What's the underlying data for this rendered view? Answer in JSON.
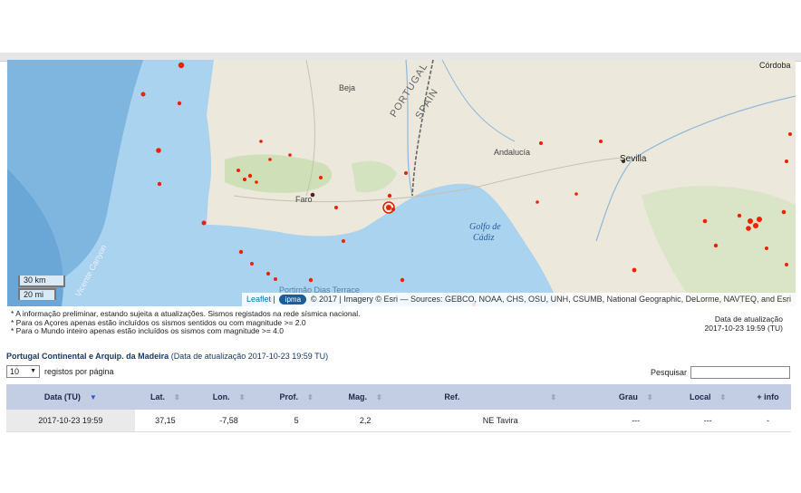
{
  "map": {
    "labels": {
      "beja": "Beja",
      "portugal": "PORTUGAL",
      "spain": "SPAIN",
      "andalucia": "Andalucía",
      "sevilla": "Sevilla",
      "cordoba": "Córdoba",
      "faro": "Faro",
      "golfo1": "Golfo de",
      "golfo2": "Cádiz",
      "canyon": "Vicente Canyon",
      "terrace": "Portimão Dias Terrace"
    },
    "scale_km": "30 km",
    "scale_mi": "20 mi",
    "attribution_leaflet": "Leaflet",
    "attribution_logo": "ipma",
    "attribution_text": "© 2017 | Imagery © Esri — Sources: GEBCO, NOAA, CHS, OSU, UNH, CSUMB, National Geographic, DeLorme, NAVTEQ, and Esri",
    "colors": {
      "ocean": "#a9d3ee",
      "deep_ocean": "#7fb6e0",
      "land": "#ece8dc",
      "event": "#ee2200"
    }
  },
  "notes": [
    "* A informação preliminar, estando sujeita a atualizações. Sismos registados na rede sísmica nacional.",
    "* Para os Açores apenas estão incluídos os sismos sentidos ou com magnitude >= 2.0",
    "* Para o Mundo inteiro apenas estão incluídos os sismos com magnitude >= 4.0"
  ],
  "update": {
    "label": "Data de atualização",
    "value": "2017-10-23 19:59 (TU)"
  },
  "section": {
    "title": "Portugal Continental e Arquip. da Madeira",
    "subtitle": "(Data de atualização 2017-10-23 19:59 TU)"
  },
  "pagesize": {
    "value": "10",
    "label": "registos por página"
  },
  "search": {
    "label": "Pesquisar"
  },
  "table": {
    "headers": [
      "Data (TU)",
      "Lat.",
      "Lon.",
      "Prof.",
      "Mag.",
      "Ref.",
      "Grau",
      "Local",
      "+ info"
    ],
    "rows": [
      [
        "2017-10-23 19:59",
        "37,15",
        "-7,58",
        "5",
        "2,2",
        "NE Tavira",
        "---",
        "---",
        "-"
      ]
    ]
  }
}
